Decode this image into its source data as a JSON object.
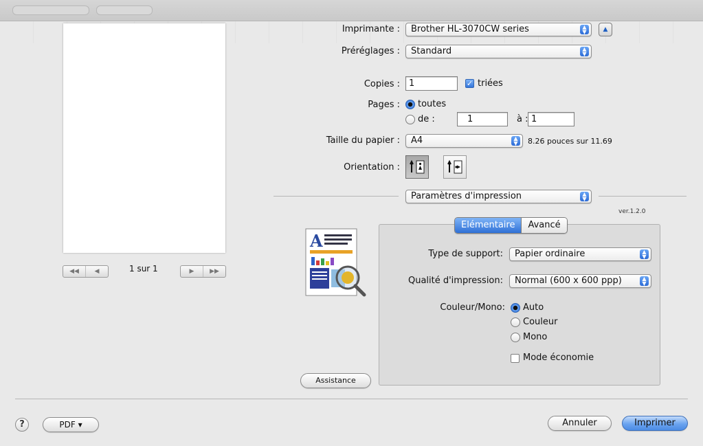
{
  "preview": {
    "page_indicator": "1 sur 1",
    "nav_first": "◀◀",
    "nav_prev": "◀",
    "nav_next": "▶",
    "nav_last": "▶▶"
  },
  "printer": {
    "label": "Imprimante :",
    "value": "Brother HL-3070CW series",
    "expand_icon": "chevron-up-icon"
  },
  "presets": {
    "label": "Préréglages :",
    "value": "Standard"
  },
  "copies": {
    "label": "Copies :",
    "value": "1",
    "collated_label": "triées",
    "collated_checked": true
  },
  "pages": {
    "label": "Pages :",
    "all_label": "toutes",
    "range_label": "de :",
    "from_value": "1",
    "to_label": "à :",
    "to_value": "1",
    "selected": "all"
  },
  "paper_size": {
    "label": "Taille du papier :",
    "value": "A4",
    "dimensions": "8.26 pouces sur 11.69"
  },
  "orientation": {
    "label": "Orientation :",
    "selected": "portrait"
  },
  "panel_select": {
    "value": "Paramètres d'impression"
  },
  "version": "ver.1.2.0",
  "tabs": [
    {
      "label": "Elémentaire",
      "selected": true
    },
    {
      "label": "Avancé",
      "selected": false
    }
  ],
  "basic": {
    "media_type": {
      "label": "Type de support:",
      "value": "Papier ordinaire"
    },
    "quality": {
      "label": "Qualité d'impression:",
      "value": "Normal (600 x 600 ppp)"
    },
    "color_mode": {
      "label": "Couleur/Mono:",
      "options": [
        "Auto",
        "Couleur",
        "Mono"
      ],
      "selected": "Auto"
    },
    "toner_save": {
      "label": "Mode économie",
      "checked": false
    }
  },
  "assistance_button": "Assistance",
  "help_button": "?",
  "pdf_button": "PDF ▾",
  "cancel_button": "Annuler",
  "print_button": "Imprimer",
  "colors": {
    "accent": "#3476da",
    "background": "#e9e9e9"
  }
}
